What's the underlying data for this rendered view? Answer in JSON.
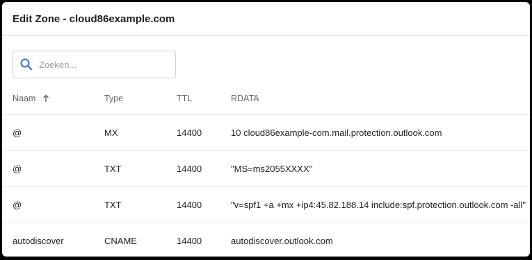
{
  "window": {
    "title": "Edit Zone - cloud86example.com"
  },
  "search": {
    "placeholder": "Zoeken...",
    "value": ""
  },
  "table": {
    "columns": {
      "name": "Naam",
      "type": "Type",
      "ttl": "TTL",
      "rdata": "RDATA"
    },
    "sort": {
      "column": "Naam",
      "direction": "ascending"
    },
    "rows": [
      {
        "name": "@",
        "type": "MX",
        "ttl": "14400",
        "rdata": "10 cloud86example-com.mail.protection.outlook.com"
      },
      {
        "name": "@",
        "type": "TXT",
        "ttl": "14400",
        "rdata": "\"MS=ms2055XXXX\""
      },
      {
        "name": "@",
        "type": "TXT",
        "ttl": "14400",
        "rdata": "\"v=spf1 +a +mx +ip4:45.82.188.14 include:spf.protection.outlook.com -all\""
      },
      {
        "name": "autodiscover",
        "type": "CNAME",
        "ttl": "14400",
        "rdata": "autodiscover.outlook.com"
      }
    ]
  },
  "colors": {
    "search_icon": "#3b6fd8",
    "text": "#222222",
    "muted": "#666666"
  },
  "icons": {
    "search": "search-icon",
    "sort": "arrow-up-icon"
  }
}
